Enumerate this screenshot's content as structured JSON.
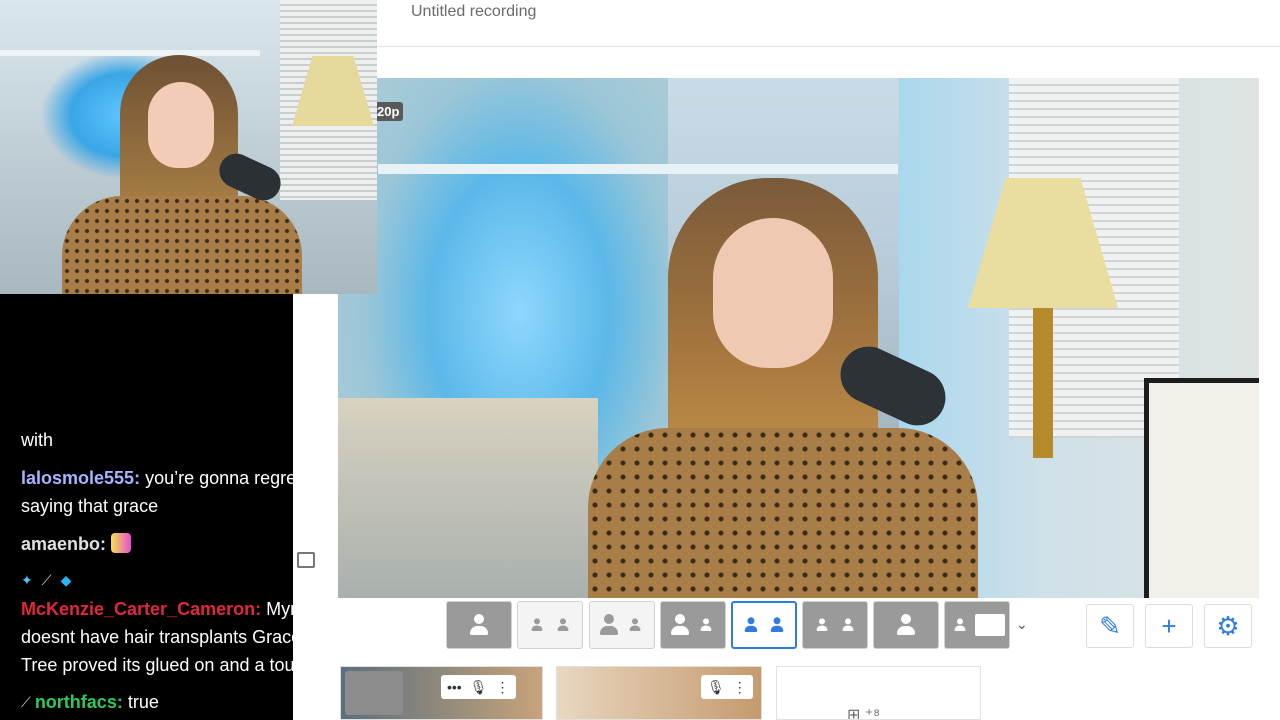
{
  "recording": {
    "title": "Untitled recording"
  },
  "stage": {
    "resolution_badge": "20p"
  },
  "chat": {
    "lines": [
      {
        "user": "",
        "message": "with"
      },
      {
        "user": "lalosmole555:",
        "message": " you’re gonna regret",
        "user_color": "#a8b4ff"
      },
      {
        "user": "",
        "message": "saying that grace"
      },
      {
        "user": "amaenbo:",
        "message": "",
        "user_color": "#e0e0e0"
      },
      {
        "user": "McKenzie_Carter_Cameron:",
        "message": " Myron",
        "user_color": "#e0283c"
      },
      {
        "user": "",
        "message": "doesnt have hair transplants Grace..."
      },
      {
        "user": "",
        "message": "Tree proved its glued on and a toupee"
      },
      {
        "user": "northfacs:",
        "message": " true",
        "user_color": "#2ec95a"
      }
    ]
  },
  "layout_buttons": [
    {
      "name": "layout-solo",
      "style": "gray"
    },
    {
      "name": "layout-pip-grid",
      "style": "light"
    },
    {
      "name": "layout-presenter",
      "style": "light"
    },
    {
      "name": "layout-main-sidebar",
      "style": "gray"
    },
    {
      "name": "layout-side-by-side",
      "style": "active"
    },
    {
      "name": "layout-split-grey",
      "style": "gray"
    },
    {
      "name": "layout-screen-only",
      "style": "gray"
    },
    {
      "name": "layout-screen-sidebar",
      "style": "gray"
    }
  ],
  "tools": {
    "edit_icon": "pencil-icon",
    "add_icon": "plus-icon",
    "settings_icon": "gear-icon"
  },
  "colors": {
    "accent": "#2f7de1",
    "chat_bg": "#000000"
  }
}
